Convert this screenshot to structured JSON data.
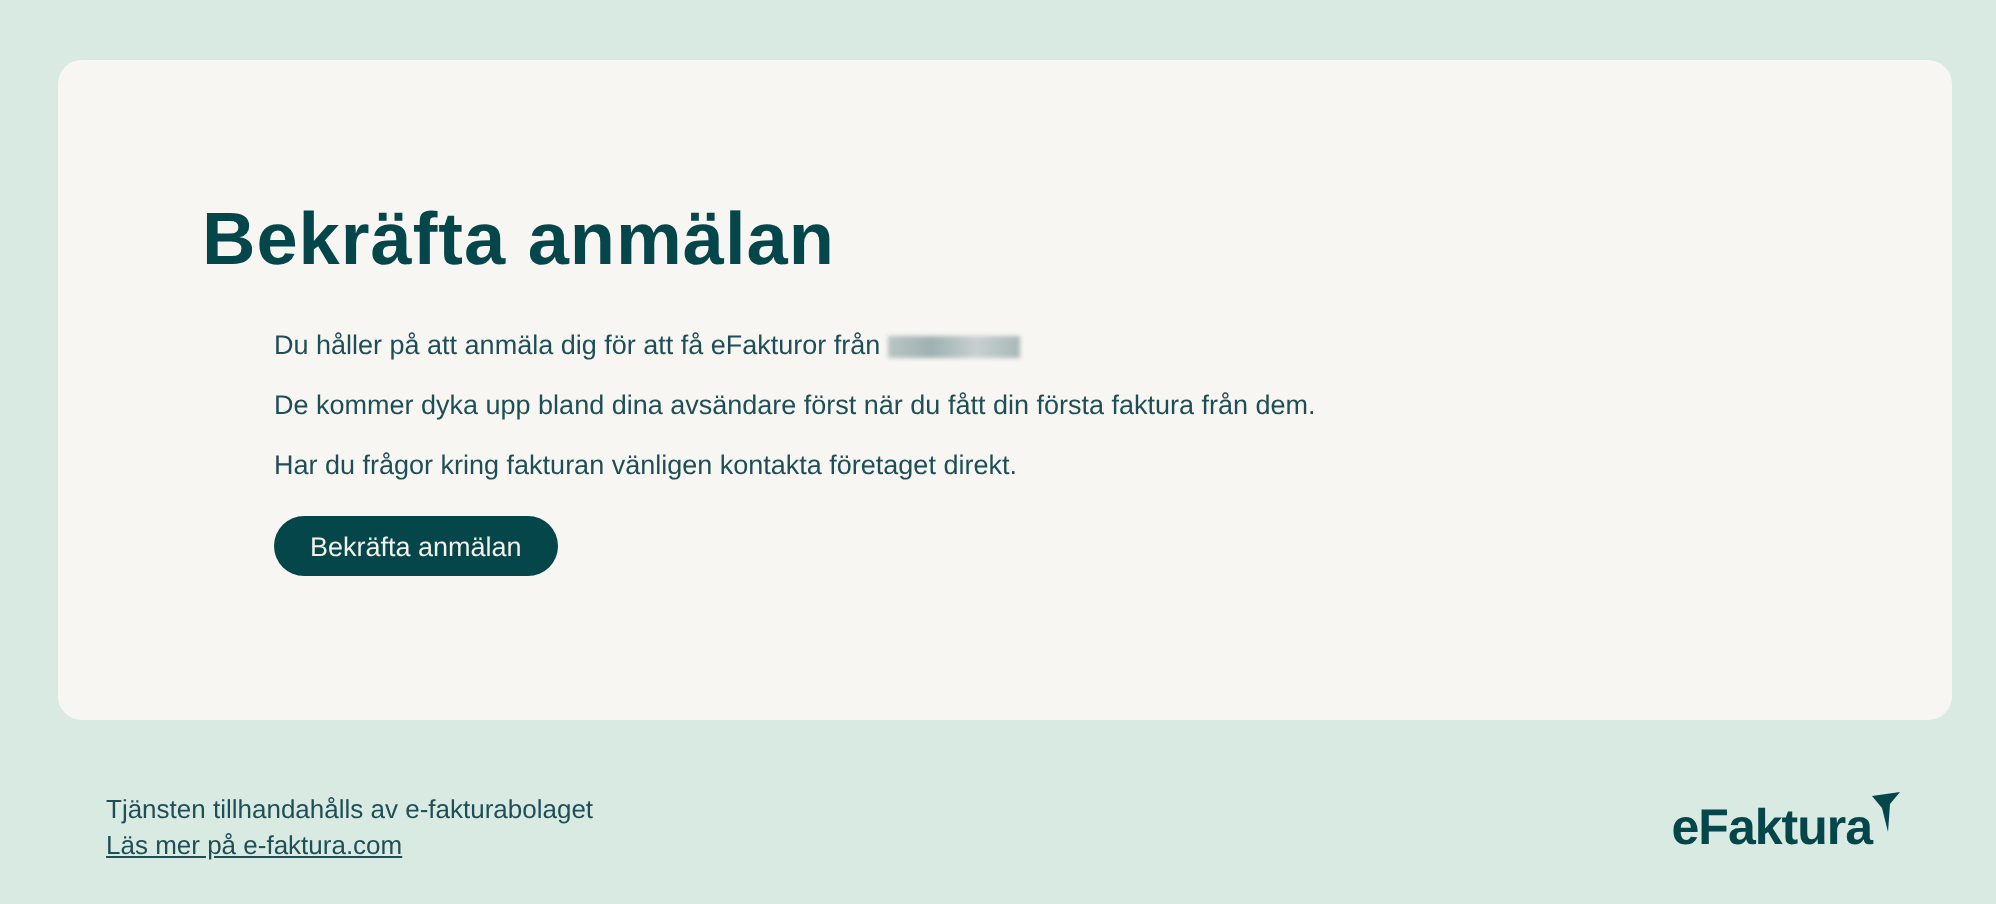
{
  "card": {
    "title": "Bekräfta anmälan",
    "paragraphs": [
      {
        "text": "Du håller på att anmäla dig för att få eFakturor från",
        "redacted": true
      },
      {
        "text": "De kommer dyka upp bland dina avsändare först när du fått din första faktura från dem.",
        "redacted": false
      },
      {
        "text": "Har du frågor kring fakturan vänligen kontakta företaget direkt.",
        "redacted": false
      }
    ],
    "button": "Bekräfta anmälan"
  },
  "footer": {
    "text": "Tjänsten tillhandahålls av e-fakturabolaget",
    "link": "Läs mer på e-faktura.com",
    "logo": "eFaktura"
  }
}
